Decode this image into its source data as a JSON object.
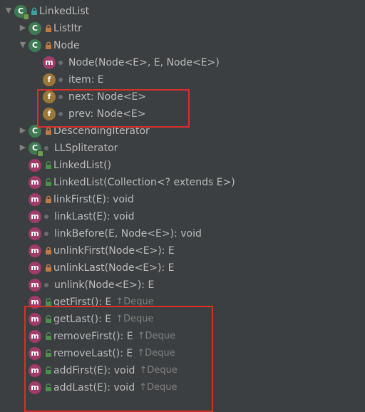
{
  "root": {
    "name": "LinkedList"
  },
  "children": {
    "listItr": "ListItr",
    "node": "Node",
    "descIter": "DescendingIterator",
    "llsplit": "LLSpliterator"
  },
  "nodeMembers": {
    "ctor": "Node(Node<E>, E, Node<E>)",
    "item": "item: E",
    "next": "next: Node<E>",
    "prev": "prev: Node<E>"
  },
  "methods": {
    "ctor0": "LinkedList()",
    "ctor1": "LinkedList(Collection<? extends E>)",
    "linkFirst": "linkFirst(E): void",
    "linkLast": "linkLast(E): void",
    "linkBefore": "linkBefore(E, Node<E>): void",
    "unlinkFirst": "unlinkFirst(Node<E>): E",
    "unlinkLast": "unlinkLast(Node<E>): E",
    "unlink": "unlink(Node<E>): E",
    "getFirst": "getFirst(): E",
    "getLast": "getLast(): E",
    "removeFirst": "removeFirst(): E",
    "removeLast": "removeLast(): E",
    "addFirst": "addFirst(E): void",
    "addLast": "addLast(E): void"
  },
  "inheritLabel": "↑Deque",
  "chart_data": null
}
